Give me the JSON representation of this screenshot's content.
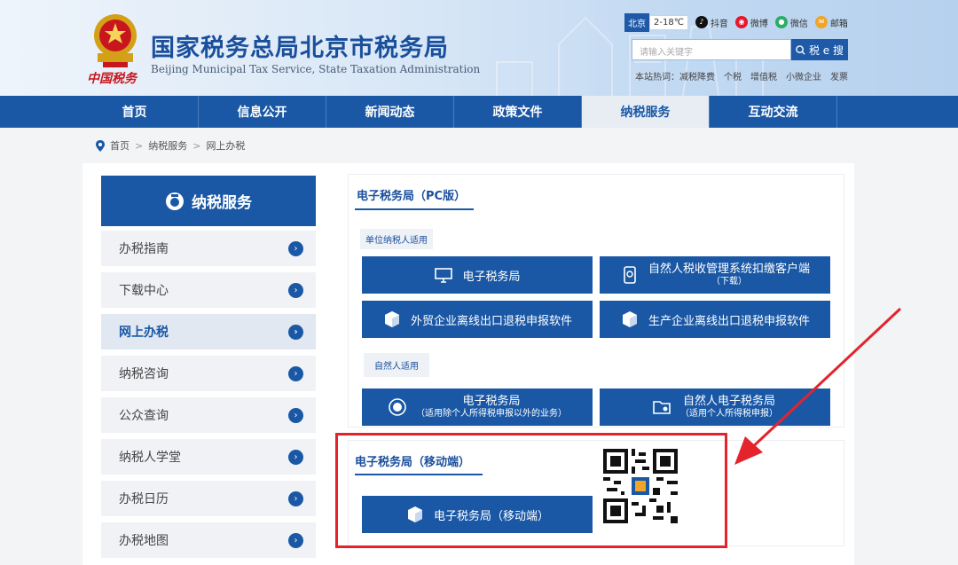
{
  "header": {
    "title": "国家税务总局北京市税务局",
    "subtitle": "Beijing Municipal Tax Service, State Taxation Administration",
    "brand_script": "中国税务",
    "city": "北京",
    "temperature": "2-18℃",
    "social": [
      {
        "label": "抖音",
        "icon": "douyin-icon",
        "color": "#111111"
      },
      {
        "label": "微博",
        "icon": "weibo-icon",
        "color": "#e6162d"
      },
      {
        "label": "微信",
        "icon": "wechat-icon",
        "color": "#2aae67"
      },
      {
        "label": "邮箱",
        "icon": "mail-icon",
        "color": "#f0a428"
      }
    ],
    "search_placeholder": "请输入关键字",
    "search_button": "税 e 搜",
    "hot_label": "本站热词：",
    "hot_words": [
      "减税降费",
      "个税",
      "增值税",
      "小微企业",
      "发票"
    ]
  },
  "nav": [
    {
      "label": "首页",
      "active": false
    },
    {
      "label": "信息公开",
      "active": false
    },
    {
      "label": "新闻动态",
      "active": false
    },
    {
      "label": "政策文件",
      "active": false
    },
    {
      "label": "纳税服务",
      "active": true
    },
    {
      "label": "互动交流",
      "active": false
    }
  ],
  "breadcrumb": [
    "首页",
    "纳税服务",
    "网上办税"
  ],
  "breadcrumb_sep": ">",
  "sidebar": {
    "title": "纳税服务",
    "items": [
      {
        "label": "办税指南",
        "active": false
      },
      {
        "label": "下载中心",
        "active": false
      },
      {
        "label": "网上办税",
        "active": true
      },
      {
        "label": "纳税咨询",
        "active": false
      },
      {
        "label": "公众查询",
        "active": false
      },
      {
        "label": "纳税人学堂",
        "active": false
      },
      {
        "label": "办税日历",
        "active": false
      },
      {
        "label": "办税地图",
        "active": false
      }
    ]
  },
  "pc_section": {
    "title": "电子税务局（PC版）",
    "tag_org": "单位纳税人适用",
    "tag_person": "自然人适用",
    "buttons": {
      "etax": "电子税务局",
      "natural_client": "自然人税收管理系统扣缴客户端",
      "natural_client_note": "（下载）",
      "foreign_trade": "外贸企业离线出口退税申报软件",
      "production": "生产企业离线出口退税申报软件",
      "etax_person": "电子税务局",
      "etax_person_note": "（适用除个人所得税申报以外的业务）",
      "natural_etax": "自然人电子税务局",
      "natural_etax_note": "（适用个人所得税申报）"
    }
  },
  "mobile_section": {
    "title": "电子税务局（移动端）",
    "button": "电子税务局（移动端）"
  },
  "colors": {
    "primary": "#1a58a6",
    "highlight": "#e4232c"
  }
}
